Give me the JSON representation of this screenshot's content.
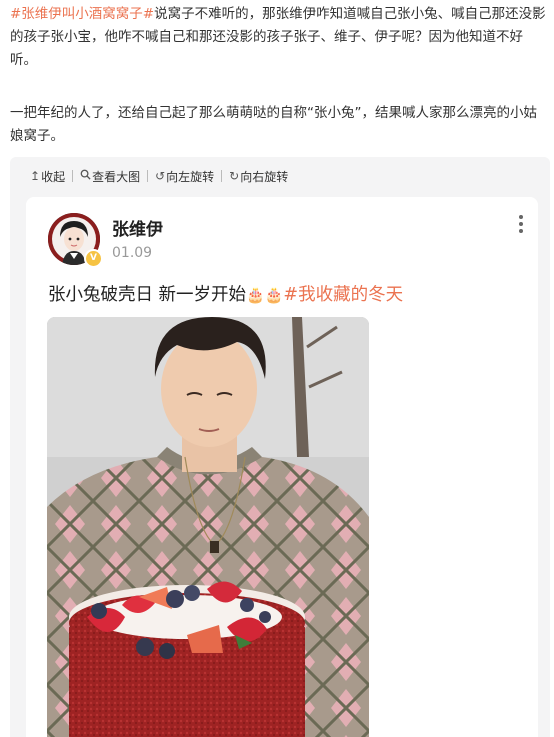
{
  "article": {
    "p1": {
      "hashtag": "#张维伊叫小酒窝窝子#",
      "text": "说窝子不难听的，那张维伊咋知道喊自己张小兔、喊自己那还没影的孩子张小宝，他咋不喊自己和那还没影的孩子张子、维子、伊子呢？因为他知道不好听。"
    },
    "p2": "一把年纪的人了，还给自己起了那么萌萌哒的自称“张小兔”，结果喊人家那么漂亮的小姑娘窝子。"
  },
  "toolbar": {
    "collapse": "收起",
    "view_large": "查看大图",
    "rotate_left": "向左旋转",
    "rotate_right": "向右旋转"
  },
  "post": {
    "username": "张维伊",
    "date": "01.09",
    "text": "张小兔破壳日 新一岁开始",
    "emojis": "🎂🎂",
    "hashtag": "#我收藏的冬天",
    "verify_badge": "V",
    "colors": {
      "hashtag": "#eb7350",
      "verify": "#f6c343"
    }
  }
}
